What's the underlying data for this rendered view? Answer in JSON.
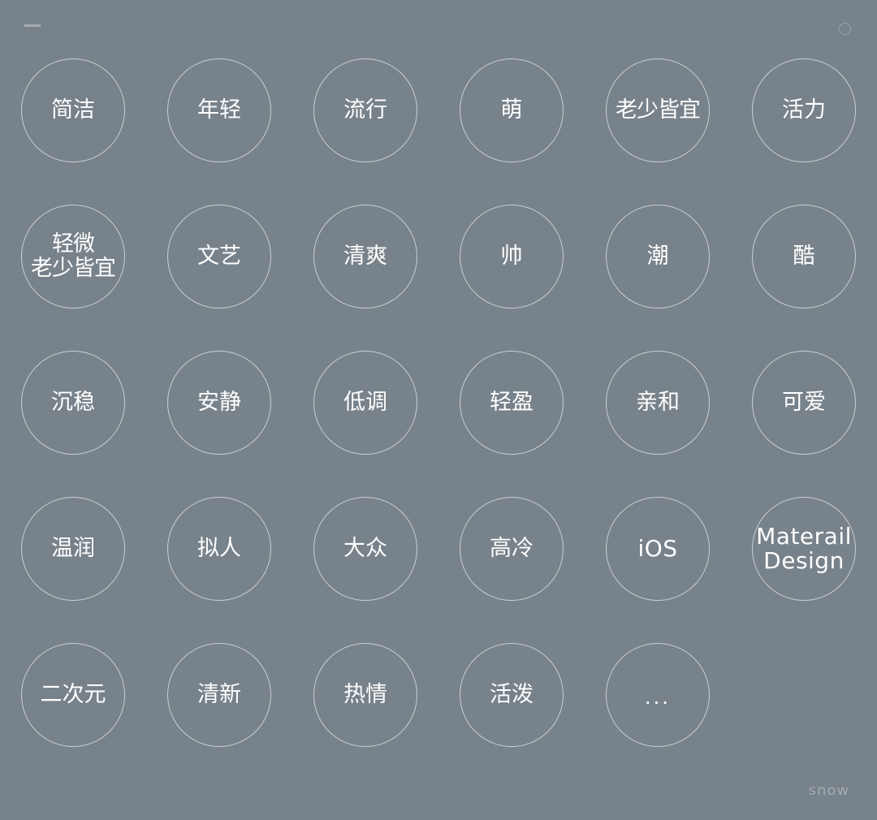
{
  "window": {
    "minimize_icon": "minus-bar-icon",
    "corner_icon": "circle-outline-icon"
  },
  "tags": [
    {
      "label": "简洁"
    },
    {
      "label": "年轻"
    },
    {
      "label": "流行"
    },
    {
      "label": "萌"
    },
    {
      "label": "老少皆宜"
    },
    {
      "label": "活力"
    },
    {
      "label": "轻微\n老少皆宜"
    },
    {
      "label": "文艺"
    },
    {
      "label": "清爽"
    },
    {
      "label": "帅"
    },
    {
      "label": "潮"
    },
    {
      "label": "酷"
    },
    {
      "label": "沉稳"
    },
    {
      "label": "安静"
    },
    {
      "label": "低调"
    },
    {
      "label": "轻盈"
    },
    {
      "label": "亲和"
    },
    {
      "label": "可爱"
    },
    {
      "label": "温润"
    },
    {
      "label": "拟人"
    },
    {
      "label": "大众"
    },
    {
      "label": "高冷"
    },
    {
      "label": "iOS"
    },
    {
      "label": "Materail\nDesign"
    },
    {
      "label": "二次元"
    },
    {
      "label": "清新"
    },
    {
      "label": "热情"
    },
    {
      "label": "活泼"
    },
    {
      "label": "..."
    }
  ],
  "watermark": "snow"
}
